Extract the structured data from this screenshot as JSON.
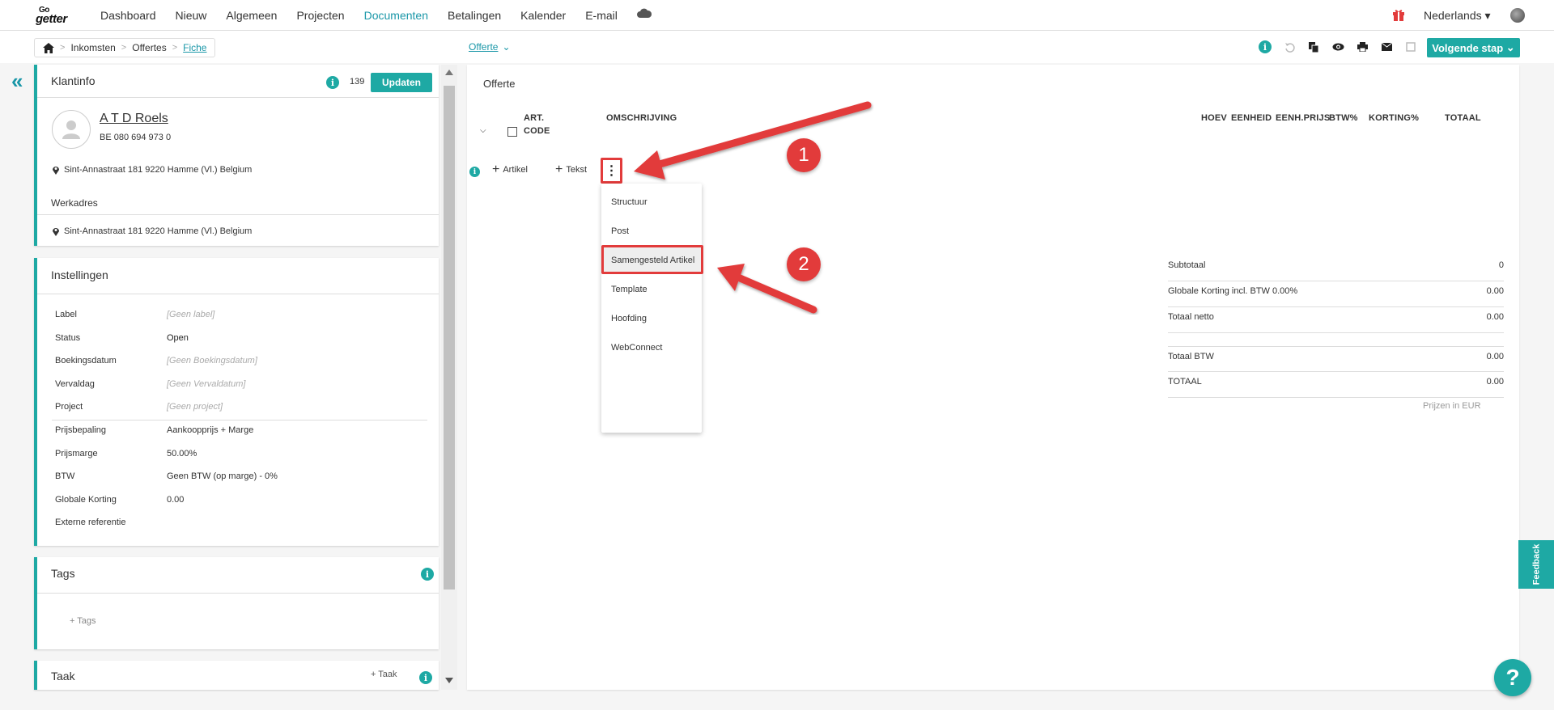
{
  "nav": {
    "items": [
      "Dashboard",
      "Nieuw",
      "Algemeen",
      "Projecten",
      "Documenten",
      "Betalingen",
      "Kalender",
      "E-mail"
    ],
    "active": "Documenten",
    "language": "Nederlands",
    "logo_top": "Go",
    "logo_bottom": "getter"
  },
  "breadcrumb": {
    "items": [
      "Inkomsten",
      "Offertes"
    ],
    "current": "Fiche"
  },
  "doc_type": "Offerte",
  "next_step_label": "Volgende stap",
  "klantinfo": {
    "title": "Klantinfo",
    "count": "139",
    "update_label": "Updaten",
    "name": "A T D Roels",
    "vat": "BE 080 694 973 0",
    "address": "Sint-Annastraat 181 9220 Hamme (Vl.) Belgium",
    "werkadres_label": "Werkadres",
    "werkadres": "Sint-Annastraat 181 9220 Hamme (Vl.) Belgium"
  },
  "instellingen": {
    "title": "Instellingen",
    "rows": [
      {
        "label": "Label",
        "value": "[Geen label]"
      },
      {
        "label": "Status",
        "value": "Open"
      },
      {
        "label": "Boekingsdatum",
        "value": "[Geen Boekingsdatum]"
      },
      {
        "label": "Vervaldag",
        "value": "[Geen Vervaldatum]"
      },
      {
        "label": "Project",
        "value": "[Geen project]"
      },
      {
        "label": "Prijsbepaling",
        "value": "Aankoopprijs + Marge"
      },
      {
        "label": "Prijsmarge",
        "value": "50.00%"
      },
      {
        "label": "BTW",
        "value": "Geen BTW (op marge) - 0%"
      },
      {
        "label": "Globale Korting",
        "value": "0.00"
      },
      {
        "label": "Externe referentie",
        "value": ""
      }
    ]
  },
  "tags": {
    "title": "Tags",
    "add_label": "Tags"
  },
  "taak": {
    "title": "Taak",
    "add_label": "Taak"
  },
  "document": {
    "title": "Offerte",
    "columns": {
      "art": "ART.",
      "code": "CODE",
      "omschrijving": "OMSCHRIJVING",
      "hoev": "HOEV",
      "eenheid": "EENHEID",
      "eenhprijs": "EENH.PRIJS",
      "btw": "BTW%",
      "korting": "KORTING%",
      "totaal": "TOTAAL"
    },
    "add_artikel": "Artikel",
    "add_tekst": "Tekst",
    "menu": [
      "Structuur",
      "Post",
      "Samengesteld Artikel",
      "Template",
      "Hoofding",
      "WebConnect"
    ],
    "totals": [
      {
        "label": "Subtotaal",
        "value": "0"
      },
      {
        "label": "Globale Korting incl. BTW 0.00%",
        "value": "0.00"
      },
      {
        "label": "Totaal netto",
        "value": "0.00"
      },
      {
        "label": "Totaal BTW",
        "value": "0.00"
      },
      {
        "label": "TOTAAL",
        "value": "0.00"
      }
    ],
    "currency_note": "Prijzen in EUR"
  },
  "annotations": {
    "badge1": "1",
    "badge2": "2"
  },
  "feedback_label": "Feedback",
  "help_label": "?",
  "colors": {
    "accent": "#1ea9a4",
    "annotation": "#e23b3b"
  }
}
